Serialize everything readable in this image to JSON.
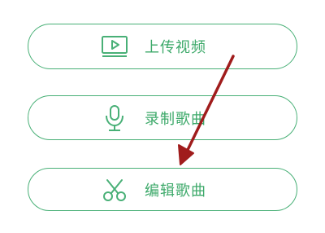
{
  "colors": {
    "accent": "#3da96a",
    "border": "#49b077",
    "annotation_arrow": "#a01c1c"
  },
  "menu": {
    "items": [
      {
        "id": "upload",
        "label": "上传视频",
        "icon": "video-play-icon"
      },
      {
        "id": "record",
        "label": "录制歌曲",
        "icon": "microphone-icon"
      },
      {
        "id": "edit",
        "label": "编辑歌曲",
        "icon": "scissors-icon"
      }
    ]
  },
  "annotation": {
    "type": "arrow",
    "points_to": "edit"
  }
}
